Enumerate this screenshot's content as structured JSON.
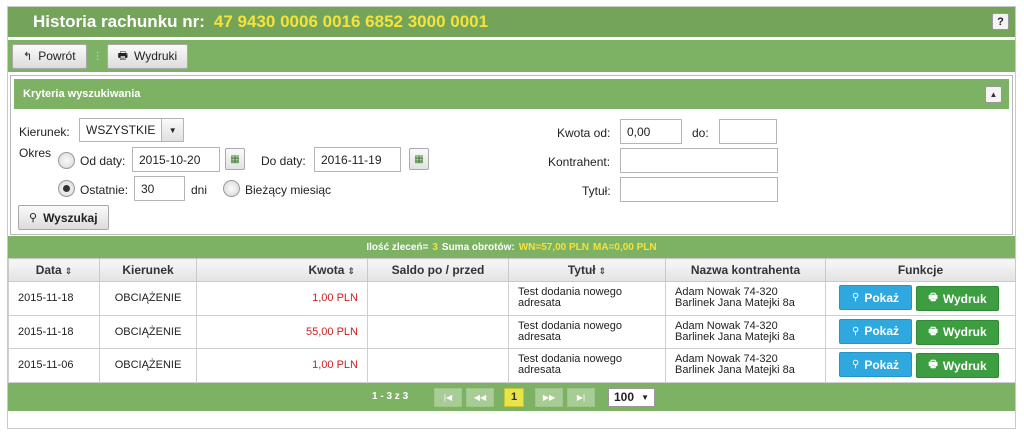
{
  "header": {
    "title": "Historia rachunku nr:",
    "account": "47 9430 0006 0016 6852 3000 0001",
    "help": "?"
  },
  "toolbar": {
    "back_label": "Powrót",
    "prints_label": "Wydruki"
  },
  "search": {
    "panel_title": "Kryteria wyszukiwania",
    "direction_label": "Kierunek:",
    "direction_value": "WSZYSTKIE",
    "period_label": "Okres",
    "from_date_label": "Od daty:",
    "from_date_value": "2015-10-20",
    "to_date_label": "Do daty:",
    "to_date_value": "2016-11-19",
    "last_label": "Ostatnie:",
    "last_value": "30",
    "days_label": "dni",
    "current_month_label": "Bieżący miesiąc",
    "amount_from_label": "Kwota od:",
    "amount_from_value": "0,00",
    "amount_to_label": "do:",
    "amount_to_value": "",
    "contractor_label": "Kontrahent:",
    "contractor_value": "",
    "title_label": "Tytuł:",
    "title_value": "",
    "search_button": "Wyszukaj"
  },
  "summary": {
    "count_label": "Ilość zleceń=",
    "count_value": "3",
    "turnover_label": "Suma obrotów:",
    "wn_value": "WN=57,00 PLN",
    "ma_value": "MA=0,00 PLN"
  },
  "table": {
    "columns": [
      "Data",
      "Kierunek",
      "Kwota",
      "Saldo po / przed",
      "Tytuł",
      "Nazwa kontrahenta",
      "Funkcje"
    ],
    "rows": [
      {
        "date": "2015-11-18",
        "direction": "OBCIĄŻENIE",
        "amount": "1,00 PLN",
        "balance": "",
        "title": "Test dodania nowego adresata",
        "contractor_line1": "Adam Nowak 74-320",
        "contractor_line2": "Barlinek Jana Matejki 8a"
      },
      {
        "date": "2015-11-18",
        "direction": "OBCIĄŻENIE",
        "amount": "55,00 PLN",
        "balance": "",
        "title": "Test dodania nowego adresata",
        "contractor_line1": "Adam Nowak 74-320",
        "contractor_line2": "Barlinek Jana Matejki 8a"
      },
      {
        "date": "2015-11-06",
        "direction": "OBCIĄŻENIE",
        "amount": "1,00 PLN",
        "balance": "",
        "title": "Test dodania nowego adresata",
        "contractor_line1": "Adam Nowak 74-320",
        "contractor_line2": "Barlinek Jana Matejki 8a"
      }
    ],
    "show_label": "Pokaż",
    "print_label": "Wydruk"
  },
  "pager": {
    "info": "1 - 3 z 3",
    "current_page": "1",
    "page_size": "100"
  },
  "icons": {
    "back": "arrow-back-icon",
    "print": "printer-icon",
    "search": "magnifier-icon",
    "calendar": "calendar-icon"
  },
  "colors": {
    "header_green": "#73a45a",
    "bar_green": "#7db265",
    "account_yellow": "#f5e23a",
    "amount_red": "#cc1f1f",
    "show_blue": "#2fa7df",
    "print_green": "#3c9e40"
  }
}
